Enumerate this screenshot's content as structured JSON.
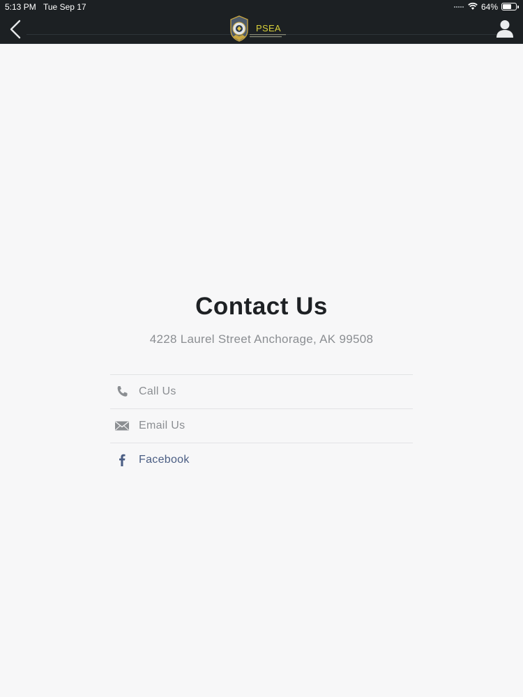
{
  "status_bar": {
    "time": "5:13 PM",
    "date": "Tue Sep 17",
    "battery": "64%",
    "battery_level": 0.64
  },
  "nav": {
    "logo_text": "PSEA",
    "back_icon": "chevron-left-icon",
    "profile_icon": "user-icon"
  },
  "contact": {
    "title": "Contact Us",
    "address": "4228 Laurel Street Anchorage, AK 99508",
    "items": [
      {
        "label": "Call Us",
        "icon": "phone-icon"
      },
      {
        "label": "Email Us",
        "icon": "envelope-icon"
      },
      {
        "label": "Facebook",
        "icon": "facebook-icon"
      }
    ]
  },
  "colors": {
    "nav_background": "#1c2023",
    "page_background": "#f7f7f8",
    "facebook_blue": "#4a5d83",
    "logo_yellow": "#d8d03a"
  }
}
